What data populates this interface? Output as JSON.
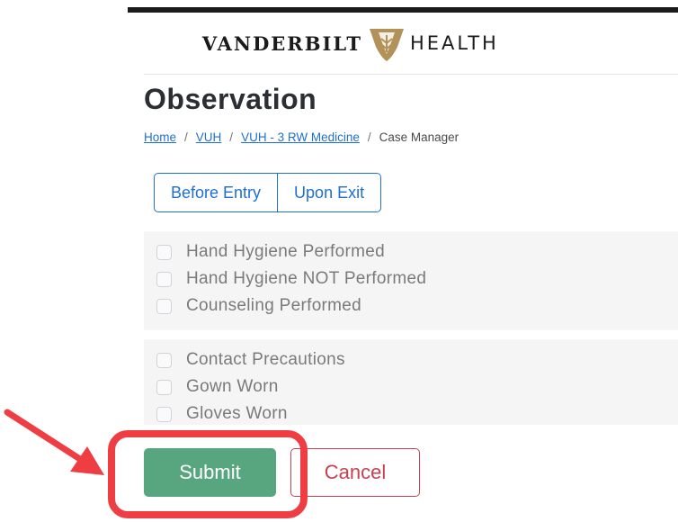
{
  "brand": {
    "name_left": "VANDERBILT",
    "name_right": "HEALTH",
    "logo_icon": "vanderbilt-oak-leaf-shield",
    "logo_color": "#b3925a"
  },
  "page": {
    "title": "Observation"
  },
  "breadcrumb": {
    "items": [
      {
        "label": "Home",
        "link": true
      },
      {
        "label": "VUH",
        "link": true
      },
      {
        "label": "VUH - 3 RW Medicine",
        "link": true
      },
      {
        "label": "Case Manager",
        "link": false
      }
    ],
    "separator": "/"
  },
  "toggle": {
    "before_label": "Before Entry",
    "exit_label": "Upon Exit"
  },
  "hygiene_group": {
    "items": [
      {
        "label": "Hand Hygiene Performed",
        "checked": false
      },
      {
        "label": "Hand Hygiene NOT Performed",
        "checked": false
      },
      {
        "label": "Counseling Performed",
        "checked": false
      }
    ]
  },
  "precaution_group": {
    "items": [
      {
        "label": "Contact Precautions",
        "checked": false
      },
      {
        "label": "Gown Worn",
        "checked": false
      },
      {
        "label": "Gloves Worn",
        "checked": false
      }
    ]
  },
  "actions": {
    "submit_label": "Submit",
    "cancel_label": "Cancel"
  },
  "colors": {
    "link": "#1f6fd1",
    "submit": "#58a67f",
    "cancel": "#c8414f",
    "annotation": "#ee3e43"
  }
}
